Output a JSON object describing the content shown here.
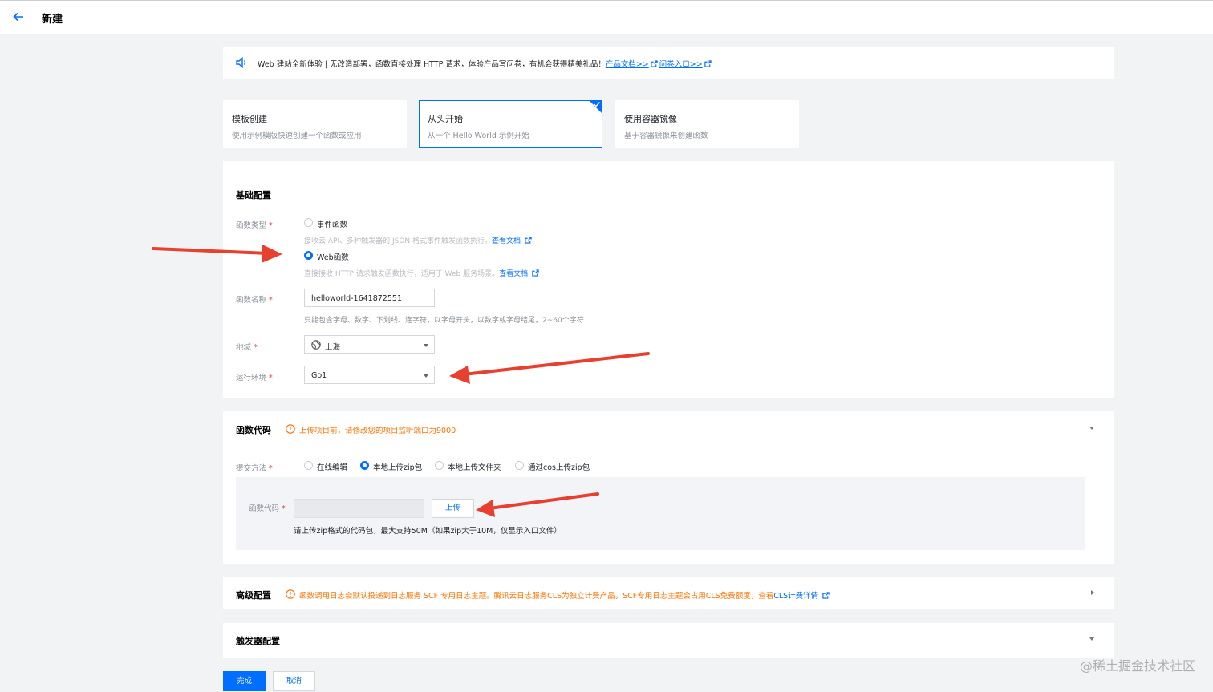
{
  "header": {
    "title": "新建"
  },
  "notice": {
    "text": "Web 建站全新体验 | 无改造部署，函数直接处理 HTTP 请求，体验产品写问卷，有机会获得精美礼品！",
    "doc_link": "产品文档>>",
    "survey_link": "问卷入口>>"
  },
  "template_cards": [
    {
      "title": "模板创建",
      "desc": "使用示例模版快速创建一个函数或应用",
      "selected": false
    },
    {
      "title": "从头开始",
      "desc": "从一个 Hello World 示例开始",
      "selected": true
    },
    {
      "title": "使用容器镜像",
      "desc": "基于容器镜像来创建函数",
      "selected": false
    }
  ],
  "basic": {
    "title": "基础配置",
    "func_type_label": "函数类型",
    "event_option": "事件函数",
    "event_hint": "接收云 API、多种触发器的 JSON 格式事件触发函数执行。",
    "web_option": "Web函数",
    "web_hint": "直接接收 HTTP 请求触发函数执行，适用于 Web 服务场景。",
    "view_doc": "查看文档",
    "selected_type": "Web函数",
    "name_label": "函数名称",
    "name_value": "helloworld-1641872551",
    "name_hint": "只能包含字母、数字、下划线、连字符，以字母开头，以数字或字母结尾，2~60个字符",
    "region_label": "地域",
    "region_value": "上海",
    "runtime_label": "运行环境",
    "runtime_value": "Go1",
    "required_mark": "*"
  },
  "code": {
    "title": "函数代码",
    "warning": "上传项目前，请修改您的项目监听端口为9000",
    "submit_label": "提交方法",
    "methods": [
      "在线编辑",
      "本地上传zip包",
      "本地上传文件夹",
      "通过cos上传zip包"
    ],
    "selected_method": "本地上传zip包",
    "code_label": "函数代码",
    "upload_button": "上传",
    "upload_tip": "请上传zip格式的代码包，最大支持50M（如果zip大于10M，仅显示入口文件）"
  },
  "advanced": {
    "title": "高级配置",
    "warning": "函数调用日志会默认投递到日志服务 SCF 专用日志主题。腾讯云日志服务CLS为独立计费产品，SCF专用日志主题会占用CLS免费额度，查看",
    "link": "CLS计费详情"
  },
  "trigger": {
    "title": "触发器配置"
  },
  "footer": {
    "confirm": "完成",
    "cancel": "取消"
  },
  "watermark": "@稀土掘金技术社区",
  "colors": {
    "primary": "#006eff",
    "warning": "#ff7200",
    "annotation_arrow": "#e8402f",
    "background": "#f2f3f5"
  }
}
